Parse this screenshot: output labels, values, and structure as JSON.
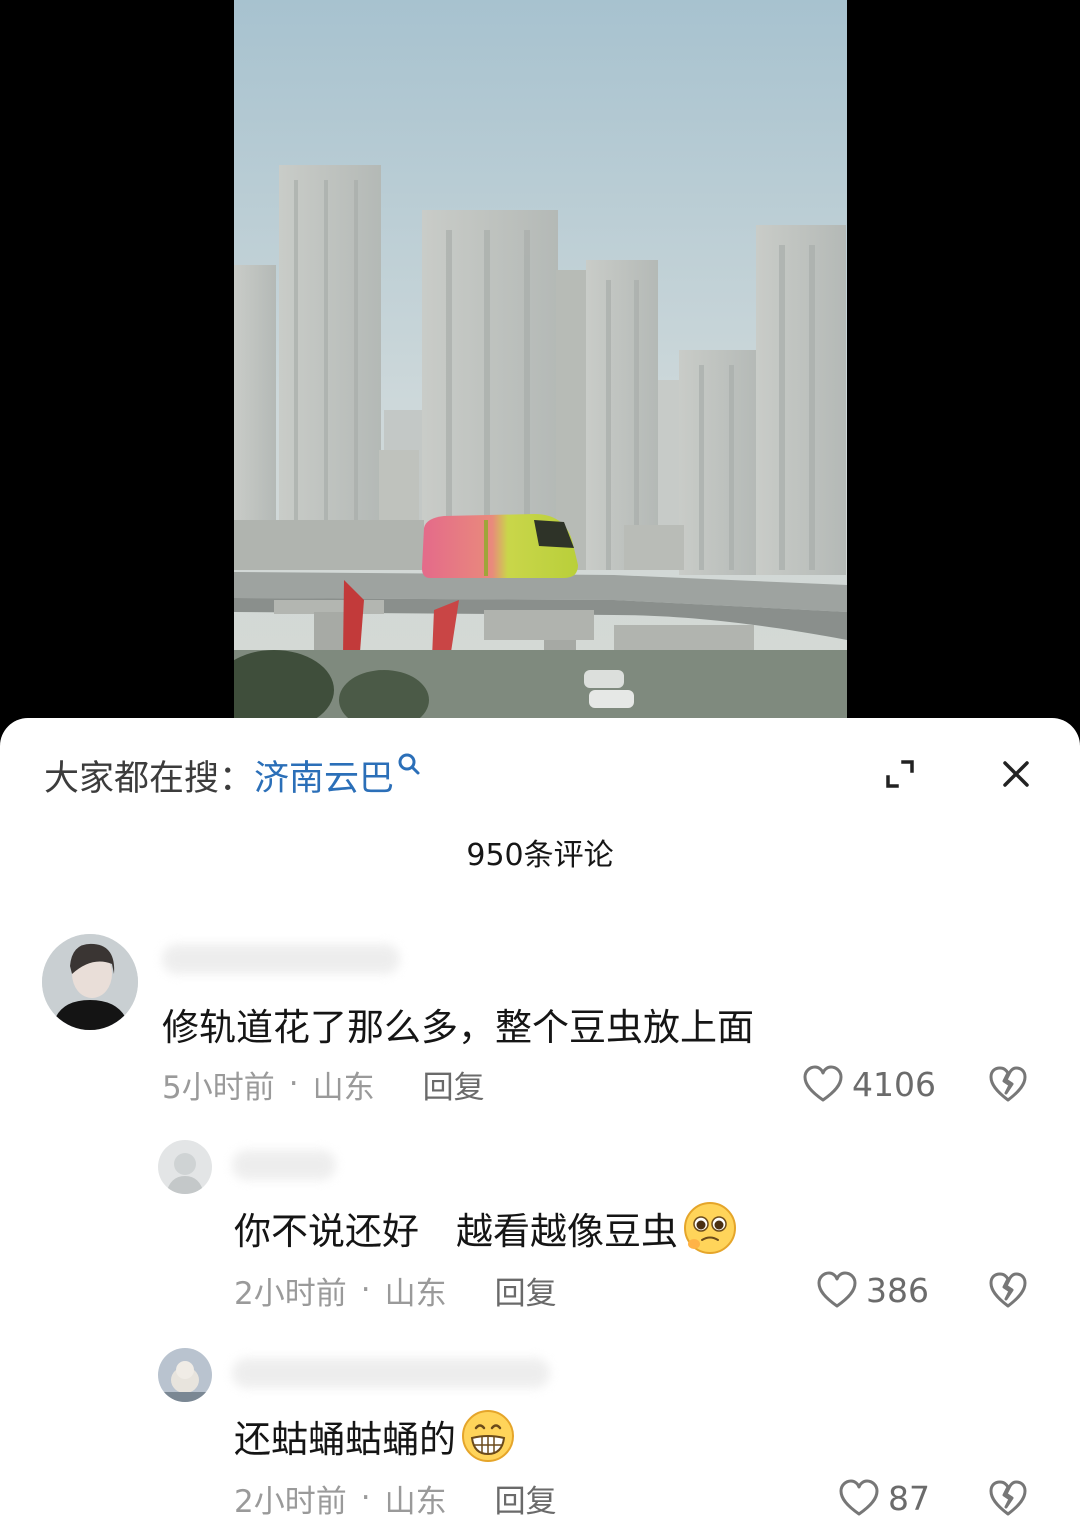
{
  "search": {
    "prefix": "大家都在搜：",
    "keyword": "济南云巴"
  },
  "comments_header": {
    "count_label": "950条评论"
  },
  "comments": [
    {
      "text": "修轨道花了那么多，整个豆虫放上面",
      "time": "5小时前",
      "location": "山东",
      "reply_label": "回复",
      "likes": "4106",
      "emoji": ""
    },
    {
      "text": "你不说还好　越看越像豆虫",
      "time": "2小时前",
      "location": "山东",
      "reply_label": "回复",
      "likes": "386",
      "emoji": "pleading-face"
    },
    {
      "text": "还蛄蛹蛄蛹的",
      "time": "2小时前",
      "location": "山东",
      "reply_label": "回复",
      "likes": "87",
      "emoji": "grinning-face"
    }
  ],
  "colors": {
    "keyword": "#2b6fb8",
    "meta": "#9a9a9a",
    "text": "#151515"
  }
}
